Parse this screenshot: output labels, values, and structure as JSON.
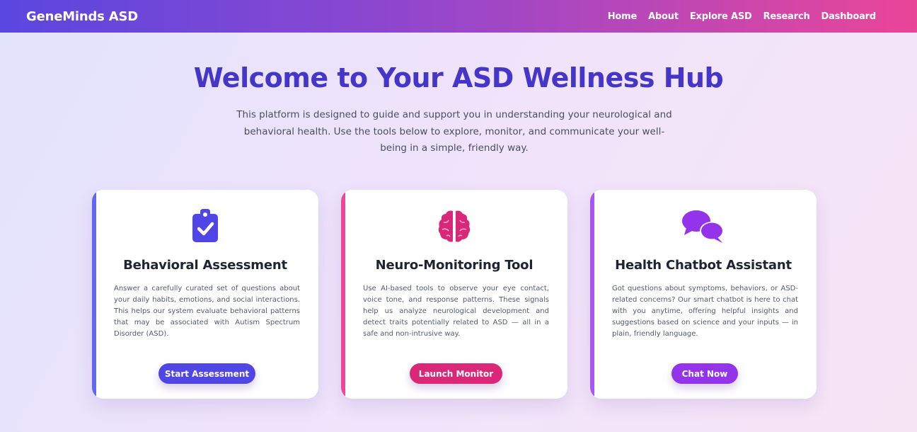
{
  "brand": "GeneMinds ASD",
  "nav": [
    "Home",
    "About",
    "Explore ASD",
    "Research",
    "Dashboard"
  ],
  "hero": {
    "title": "Welcome to Your ASD Wellness Hub",
    "description": "This platform is designed to guide and support you in understanding your neurological and behavioral health. Use the tools below to explore, monitor, and communicate your well-being in a simple, friendly way."
  },
  "cards": [
    {
      "title": "Behavioral Assessment",
      "text": "Answer a carefully curated set of questions about your daily habits, emotions, and social interactions. This helps our system evaluate behavioral patterns that may be associated with Autism Spectrum Disorder (ASD).",
      "button": "Start Assessment",
      "icon": "clipboard-check-icon",
      "color": "#4f46e5"
    },
    {
      "title": "Neuro-Monitoring Tool",
      "text": "Use AI-based tools to observe your eye contact, voice tone, and response patterns. These signals help us analyze neurological development and detect traits potentially related to ASD — all in a safe and non-intrusive way.",
      "button": "Launch Monitor",
      "icon": "brain-icon",
      "color": "#db2777"
    },
    {
      "title": "Health Chatbot Assistant",
      "text": "Got questions about symptoms, behaviors, or ASD-related concerns? Our smart chatbot is here to chat with you anytime, offering helpful insights and suggestions based on science and your inputs — in plain, friendly language.",
      "button": "Chat Now",
      "icon": "chat-bubbles-icon",
      "color": "#9333ea"
    }
  ]
}
